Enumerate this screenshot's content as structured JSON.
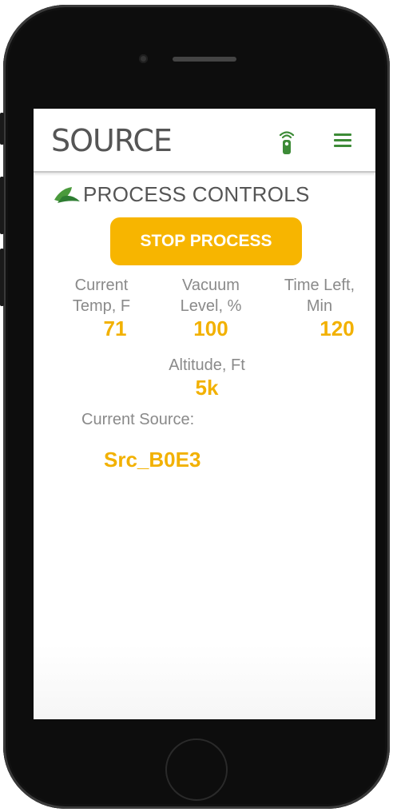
{
  "header": {
    "logo_text": "SOURCE",
    "remote_icon": "remote-control-icon",
    "menu_icon": "hamburger-menu-icon"
  },
  "section": {
    "title": "PROCESS CONTROLS",
    "icon": "leaf-icon"
  },
  "controls": {
    "stop_label": "STOP PROCESS"
  },
  "stats": {
    "temp": {
      "label_line1": "Current",
      "label_line2": "Temp, F",
      "value": "71"
    },
    "vacuum": {
      "label_line1": "Vacuum",
      "label_line2": "Level, %",
      "value": "100"
    },
    "time": {
      "label_line1": "Time Left,",
      "label_line2": "Min",
      "value": "120"
    },
    "altitude": {
      "label": "Altitude, Ft",
      "value": "5k"
    }
  },
  "source": {
    "label": "Current Source:",
    "value": "Src_B0E3"
  },
  "colors": {
    "accent_yellow": "#f7b500",
    "brand_green": "#3d8b37",
    "label_gray": "#8a8a8a",
    "title_gray": "#555555"
  }
}
